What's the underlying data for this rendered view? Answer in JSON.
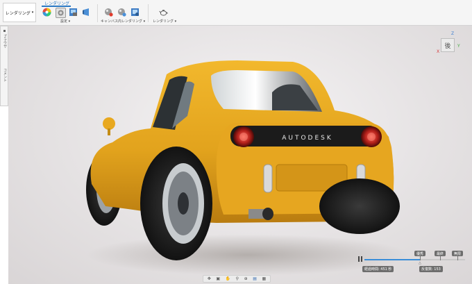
{
  "toolbar": {
    "workspace_label": "レンダリング",
    "workspace_caret": "▾",
    "active_tab": "レンダリング",
    "groups": [
      {
        "label": "設定 ▾"
      },
      {
        "label": "キャンバス内レンダリング ▾"
      },
      {
        "label": "レンダリング ▾"
      }
    ]
  },
  "left_panel": {
    "tab1": "ブラウザ",
    "tab2": "コメント"
  },
  "viewport": {
    "car_brand_text": "AUTODESK"
  },
  "viewcube": {
    "face_label": "後",
    "axis_z": "Z",
    "axis_x": "X",
    "axis_y": "Y"
  },
  "render_progress": {
    "quality_levels": [
      "優秀",
      "最終",
      "無限"
    ],
    "progress": 0.55,
    "elapsed_label": "経過時間: 451 秒",
    "iterations_label": "反復数: 153"
  },
  "navbar": {
    "icons": [
      "orbit-icon",
      "look-at-icon",
      "pan-icon",
      "zoom-icon",
      "zoom-window-icon",
      "display-icon",
      "grid-icon"
    ]
  },
  "colors": {
    "car_body": "#e0a21b",
    "accent": "#2a79c4",
    "progress": "#3a8dd8"
  }
}
